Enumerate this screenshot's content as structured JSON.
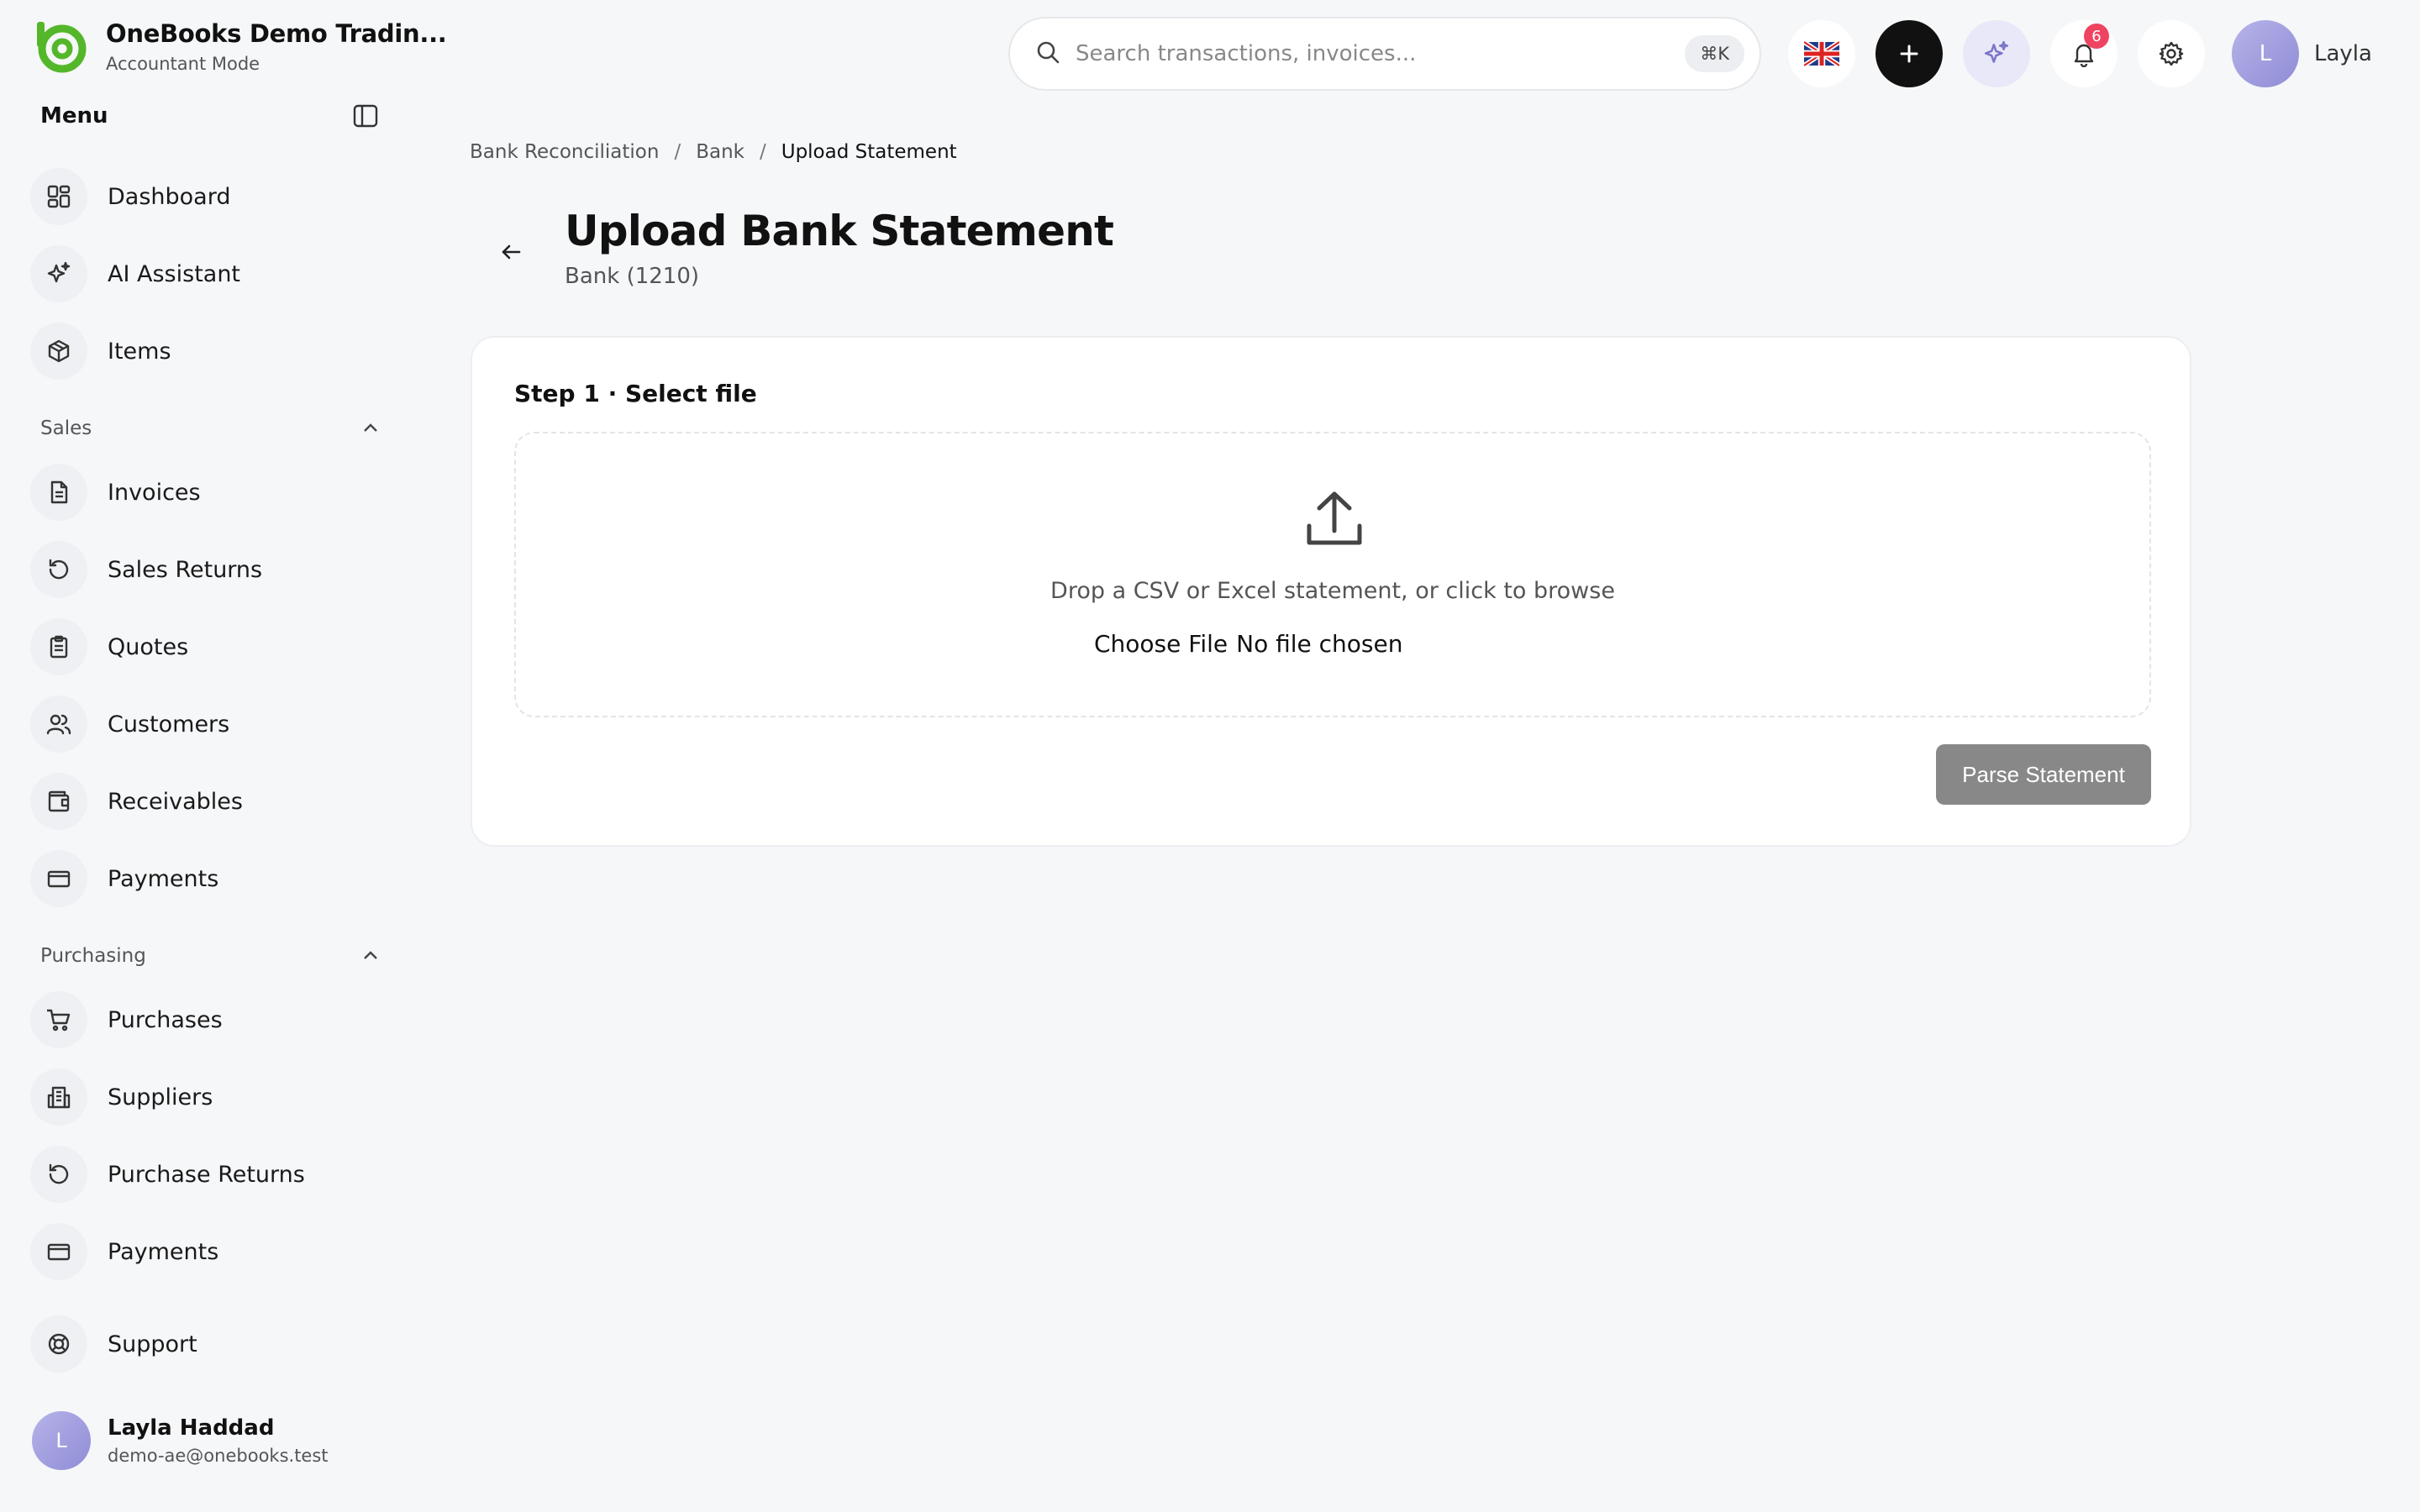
{
  "brand": {
    "name": "OneBooks Demo Tradin...",
    "mode": "Accountant Mode",
    "logo_color": "#54b72a"
  },
  "menu": {
    "label": "Menu"
  },
  "nav": {
    "dashboard": "Dashboard",
    "ai_assistant": "AI Assistant",
    "items": "Items"
  },
  "sales": {
    "heading": "Sales",
    "invoices": "Invoices",
    "sales_returns": "Sales Returns",
    "quotes": "Quotes",
    "customers": "Customers",
    "receivables": "Receivables",
    "payments": "Payments"
  },
  "purchasing": {
    "heading": "Purchasing",
    "purchases": "Purchases",
    "suppliers": "Suppliers",
    "purchase_returns": "Purchase Returns",
    "payments": "Payments"
  },
  "support": "Support",
  "profile": {
    "initial": "L",
    "name": "Layla Haddad",
    "email": "demo-ae@onebooks.test"
  },
  "topbar": {
    "search_placeholder": "Search transactions, invoices...",
    "shortcut": "⌘K",
    "notification_count": "6",
    "user_initial": "L",
    "user_name": "Layla",
    "notification_badge_color": "#ef4461"
  },
  "breadcrumb": {
    "item1": "Bank Reconciliation",
    "item2": "Bank",
    "current": "Upload Statement",
    "separator": "/"
  },
  "page": {
    "title": "Upload Bank Statement",
    "subtitle": "Bank (1210)"
  },
  "card": {
    "step": "Step 1 · Select file",
    "drop_text": "Drop a CSV or Excel statement, or click to browse",
    "choose_file": "Choose File",
    "no_file": "No file chosen",
    "parse_button": "Parse Statement"
  }
}
